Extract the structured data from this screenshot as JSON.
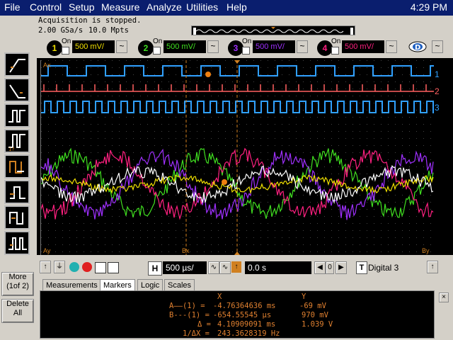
{
  "menu": {
    "items": [
      "File",
      "Control",
      "Setup",
      "Measure",
      "Analyze",
      "Utilities",
      "Help"
    ],
    "clock": "4:29 PM"
  },
  "status": {
    "acquisition": "Acquisition is stopped.",
    "sample_rate": "2.00 GSa/s",
    "memory": "10.0 Mpts"
  },
  "channels": [
    {
      "num": "1",
      "on_label": "On",
      "scale": "500 mV/",
      "color": "#f0e000"
    },
    {
      "num": "2",
      "on_label": "On",
      "scale": "500 mV/",
      "color": "#40e020"
    },
    {
      "num": "3",
      "on_label": "On",
      "scale": "500 mV/",
      "color": "#a030ff"
    },
    {
      "num": "4",
      "on_label": "On",
      "scale": "500 mV/",
      "color": "#ff2080"
    }
  ],
  "display": {
    "label_ax": "Ax",
    "label_ay": "Ay",
    "label_bx": "Bx",
    "label_by": "By",
    "digital_labels": [
      "1",
      "2",
      "3"
    ],
    "digital_colors": [
      "#30a0ff",
      "#ff6060",
      "#30a0ff"
    ]
  },
  "controls": {
    "timebase": "500 µs/",
    "delay": "0.0 s",
    "delay_step": "0",
    "digital_source": "Digital 3",
    "digital_icon": "T"
  },
  "left_buttons": {
    "more": "More\n(1of 2)",
    "delete": "Delete\nAll"
  },
  "tabs": [
    "Measurements",
    "Markers",
    "Logic",
    "Scales"
  ],
  "active_tab": "Markers",
  "markers": {
    "header_x": "X",
    "header_y": "Y",
    "rows": [
      {
        "label": "A——(1) =",
        "x": "-4.76364636 ms",
        "y": "-69 mV"
      },
      {
        "label": "B---(1) =",
        "x": "-654.55545 µs",
        "y": "970 mV"
      },
      {
        "label": "Δ =",
        "x": "4.10909091 ms",
        "y": "1.039 V"
      },
      {
        "label": "1/ΔX =",
        "x": "243.3628319 Hz",
        "y": ""
      }
    ]
  }
}
